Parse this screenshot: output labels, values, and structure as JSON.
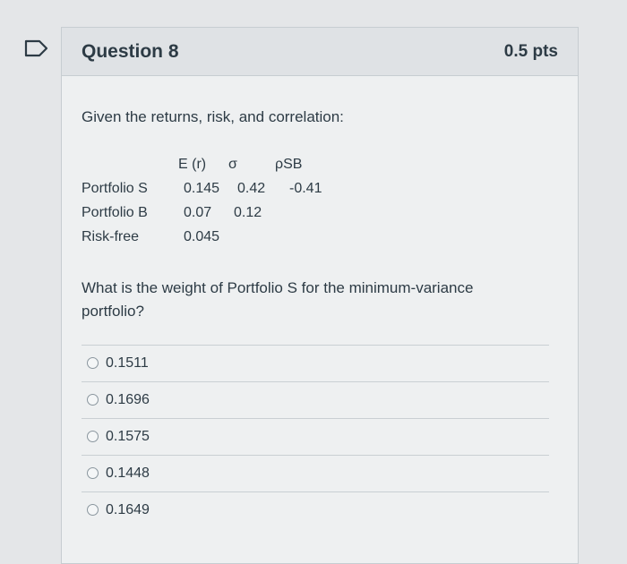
{
  "question": {
    "title": "Question 8",
    "points": "0.5 pts",
    "intro": "Given the returns, risk, and correlation:",
    "headers": [
      "E (r)",
      "σ",
      "ρSB"
    ],
    "rows": [
      {
        "label": "Portfolio S",
        "er": "0.145",
        "sigma": "0.42",
        "rho": "-0.41"
      },
      {
        "label": "Portfolio B",
        "er": "0.07",
        "sigma": "0.12",
        "rho": ""
      },
      {
        "label": "Risk-free",
        "er": "0.045",
        "sigma": "",
        "rho": ""
      }
    ],
    "prompt": "What is the weight of Portfolio S for the minimum-variance portfolio?",
    "options": [
      "0.1511",
      "0.1696",
      "0.1575",
      "0.1448",
      "0.1649"
    ]
  },
  "colors": {
    "background": "#e4e6e8",
    "card": "#eef0f1",
    "header": "#dfe2e5",
    "text": "#2d3b45"
  },
  "icons": {
    "flag": "flag-icon",
    "radio": "radio-icon"
  }
}
